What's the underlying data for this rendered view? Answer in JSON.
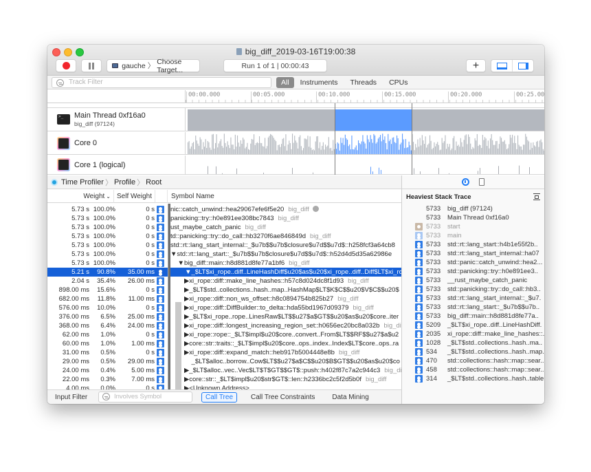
{
  "window": {
    "title": "big_diff_2019-03-16T19:00:38",
    "target": {
      "device": "gauche",
      "label": "Choose Target..."
    },
    "run_status": "Run 1 of 1  |  00:00:43",
    "add_label": "+"
  },
  "filter_bar": {
    "track_filter_placeholder": "Track Filter",
    "scopes": [
      "All",
      "Instruments",
      "Threads",
      "CPUs"
    ],
    "active_scope": "All"
  },
  "timeline": {
    "ticks": [
      "00:00.000",
      "00:05.000",
      "00:10.000",
      "00:15.000",
      "00:20.000",
      "00:25.000"
    ],
    "selection_seconds": [
      11.0,
      16.7
    ],
    "visible_range_seconds": [
      0,
      26.5
    ],
    "tracks": [
      {
        "title": "Main Thread  0xf16a0",
        "subtitle": "big_diff (97124)",
        "icon": "terminal-icon"
      },
      {
        "title": "Core 0",
        "subtitle": "",
        "icon": "core-icon"
      },
      {
        "title": "Core 1 (logical)",
        "subtitle": "",
        "icon": "core-icon"
      }
    ]
  },
  "breadcrumb": [
    "Time Profiler",
    "Profile",
    "Root"
  ],
  "columns": {
    "weight": "Weight",
    "self_weight": "Self Weight",
    "symbol": "Symbol Name"
  },
  "call_tree": [
    {
      "weight": "5.73 s",
      "pct": "100.0%",
      "self": "0 s",
      "symbol": "nic::catch_unwind::hea29067efe6f5e20",
      "lib": "big_diff",
      "nav": true
    },
    {
      "weight": "5.73 s",
      "pct": "100.0%",
      "self": "0 s",
      "symbol": "panicking::try::h0e891ee308bc7843",
      "lib": "big_diff"
    },
    {
      "weight": "5.73 s",
      "pct": "100.0%",
      "self": "0 s",
      "symbol": "ust_maybe_catch_panic",
      "lib": "big_diff"
    },
    {
      "weight": "5.73 s",
      "pct": "100.0%",
      "self": "0 s",
      "symbol": "td::panicking::try::do_call::hb3270f6ae846849d",
      "lib": "big_diff"
    },
    {
      "weight": "5.73 s",
      "pct": "100.0%",
      "self": "0 s",
      "symbol": "std::rt::lang_start_internal::_$u7b$$u7b$closure$u7d$$u7d$::h258fcf3a64cb8",
      "lib": ""
    },
    {
      "weight": "5.73 s",
      "pct": "100.0%",
      "self": "0 s",
      "symbol": "▼std::rt::lang_start::_$u7b$$u7b$closure$u7d$$u7d$::h52d4d5d35a62986e",
      "lib": ""
    },
    {
      "weight": "5.73 s",
      "pct": "100.0%",
      "self": "0 s",
      "symbol": "  ▼big_diff::main::h8d881d8fe77a1bf6",
      "lib": "big_diff"
    },
    {
      "weight": "5.21 s",
      "pct": "90.8%",
      "self": "35.00 ms",
      "symbol": "    ▼_$LT$xi_rope..diff..LineHashDiff$u20$as$u20$xi_rope..diff..Diff$LT$xi_rop",
      "lib": "",
      "selected": true
    },
    {
      "weight": "2.04 s",
      "pct": "35.4%",
      "self": "26.00 ms",
      "symbol": "▶xi_rope::diff::make_line_hashes::h57c8d024dc8f1d93",
      "lib": "big_diff"
    },
    {
      "weight": "898.00 ms",
      "pct": "15.6%",
      "self": "0 s",
      "symbol": "▶_$LT$std..collections..hash..map..HashMap$LT$K$C$$u20$V$C$$u20$",
      "lib": ""
    },
    {
      "weight": "682.00 ms",
      "pct": "11.8%",
      "self": "11.00 ms",
      "symbol": "▶xi_rope::diff::non_ws_offset::h8c0894754b825b27",
      "lib": "big_diff"
    },
    {
      "weight": "576.00 ms",
      "pct": "10.0%",
      "self": "0 s",
      "symbol": "▶xi_rope::diff::DiffBuilder::to_delta::hda55bd1967d09379",
      "lib": "big_diff"
    },
    {
      "weight": "376.00 ms",
      "pct": "6.5%",
      "self": "25.00 ms",
      "symbol": "▶_$LT$xi_rope..rope..LinesRaw$LT$$u27$a$GT$$u20$as$u20$core..iter",
      "lib": ""
    },
    {
      "weight": "368.00 ms",
      "pct": "6.4%",
      "self": "24.00 ms",
      "symbol": "▶xi_rope::diff::longest_increasing_region_set::h0656ec20bc8a032b",
      "lib": "big_diff"
    },
    {
      "weight": "62.00 ms",
      "pct": "1.0%",
      "self": "0 s",
      "symbol": "▶xi_rope::rope::_$LT$impl$u20$core..convert..From$LT$$RF$$u27$a$u2",
      "lib": ""
    },
    {
      "weight": "60.00 ms",
      "pct": "1.0%",
      "self": "1.00 ms",
      "symbol": "▶core::str::traits::_$LT$impl$u20$core..ops..index..Index$LT$core..ops..ra",
      "lib": ""
    },
    {
      "weight": "31.00 ms",
      "pct": "0.5%",
      "self": "0 s",
      "symbol": "▶xi_rope::diff::expand_match::heb917b5004448e8b",
      "lib": "big_diff"
    },
    {
      "weight": "29.00 ms",
      "pct": "0.5%",
      "self": "29.00 ms",
      "symbol": "  _$LT$alloc..borrow..Cow$LT$$u27$a$C$$u20$B$GT$$u20$as$u20$co",
      "lib": ""
    },
    {
      "weight": "24.00 ms",
      "pct": "0.4%",
      "self": "5.00 ms",
      "symbol": "▶_$LT$alloc..vec..Vec$LT$T$GT$$GT$::push::h402f87c7a2c944c3",
      "lib": "big_diff"
    },
    {
      "weight": "22.00 ms",
      "pct": "0.3%",
      "self": "7.00 ms",
      "symbol": "▶core::str::_$LT$impl$u20$str$GT$::len::h2336bc2c5f2d5b0f",
      "lib": "big_diff"
    },
    {
      "weight": "4.00 ms",
      "pct": "0.0%",
      "self": "0 s",
      "symbol": "▶<Unknown Address>",
      "lib": ""
    }
  ],
  "bottom_bar": {
    "input_filter_label": "Input Filter",
    "involves_placeholder": "Involves Symbol",
    "modes": [
      "Call Tree",
      "Call Tree Constraints",
      "Data Mining"
    ],
    "active_mode": "Call Tree"
  },
  "inspector": {
    "title": "Heaviest Stack Trace",
    "stack": [
      {
        "count": "5733",
        "name": "big_diff (97124)",
        "icon": "none"
      },
      {
        "count": "5733",
        "name": "Main Thread  0xf16a0",
        "icon": "none"
      },
      {
        "count": "5733",
        "name": "start",
        "icon": "sys",
        "dim": true
      },
      {
        "count": "5733",
        "name": "main",
        "icon": "user-dim",
        "dim": true
      },
      {
        "count": "5733",
        "name": "std::rt::lang_start::h4b1e55f2b..",
        "icon": "user"
      },
      {
        "count": "5733",
        "name": "std::rt::lang_start_internal::ha07",
        "icon": "user"
      },
      {
        "count": "5733",
        "name": "std::panic::catch_unwind::hea2...",
        "icon": "user"
      },
      {
        "count": "5733",
        "name": "std::panicking::try::h0e891ee3..",
        "icon": "user"
      },
      {
        "count": "5733",
        "name": "__rust_maybe_catch_panic",
        "icon": "user"
      },
      {
        "count": "5733",
        "name": "std::panicking::try::do_call::hb3..",
        "icon": "user"
      },
      {
        "count": "5733",
        "name": "std::rt::lang_start_internal::_$u7.",
        "icon": "user"
      },
      {
        "count": "5733",
        "name": "std::rt::lang_start::_$u7b$$u7b..",
        "icon": "user"
      },
      {
        "count": "5733",
        "name": "big_diff::main::h8d881d8fe77a..",
        "icon": "user"
      },
      {
        "count": "5209",
        "name": "_$LT$xi_rope..diff..LineHashDiff.",
        "icon": "user"
      },
      {
        "count": "2035",
        "name": "xi_rope::diff::make_line_hashes::.",
        "icon": "user"
      },
      {
        "count": "1028",
        "name": "_$LT$std..collections..hash..ma..",
        "icon": "user"
      },
      {
        "count": "534",
        "name": "_$LT$std..collections..hash..map..",
        "icon": "user"
      },
      {
        "count": "470",
        "name": "std::collections::hash::map::sear..",
        "icon": "user"
      },
      {
        "count": "458",
        "name": "std::collections::hash::map::sear..",
        "icon": "user"
      },
      {
        "count": "314",
        "name": "_$LT$std..collections..hash..table",
        "icon": "user"
      }
    ]
  },
  "colors": {
    "accent": "#1f7cf6",
    "selection": "#1560d8",
    "graph_gray": "#b4b8bf",
    "graph_blue": "#5b9bff",
    "record": "#f2252c"
  }
}
